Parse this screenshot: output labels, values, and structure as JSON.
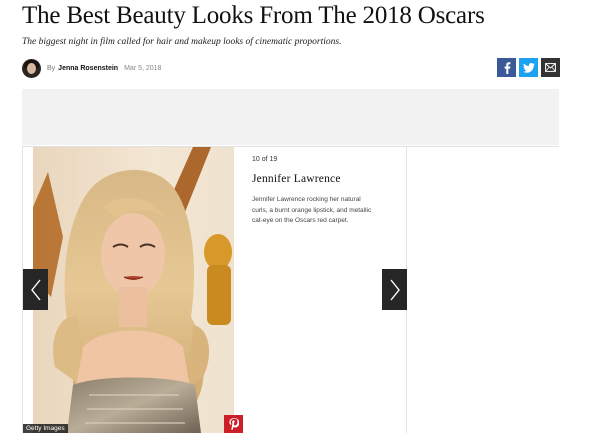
{
  "article": {
    "title": "The Best Beauty Looks From The 2018 Oscars",
    "subtitle": "The biggest night in film called for hair and makeup looks of cinematic proportions.",
    "byline_prefix": "By",
    "author": "Jenna Rosenstein",
    "date": "Mar 5, 2018"
  },
  "share": {
    "icons": [
      "facebook-icon",
      "twitter-icon",
      "mail-icon"
    ]
  },
  "gallery": {
    "counter": "10 of 19",
    "slide_title": "Jennifer Lawrence",
    "caption": "Jennifer Lawrence rocking her natural curls, a burnt orange lipstick, and metallic cat-eye on the Oscars red carpet.",
    "photo_credit": "Getty Images",
    "icons": {
      "prev": "chevron-left-icon",
      "next": "chevron-right-icon",
      "pin": "pinterest-icon"
    }
  },
  "colors": {
    "facebook": "#3b5998",
    "twitter": "#1da1f2",
    "mail": "#333333",
    "pinterest": "#cb2027",
    "nav_arrow": "#262626"
  }
}
